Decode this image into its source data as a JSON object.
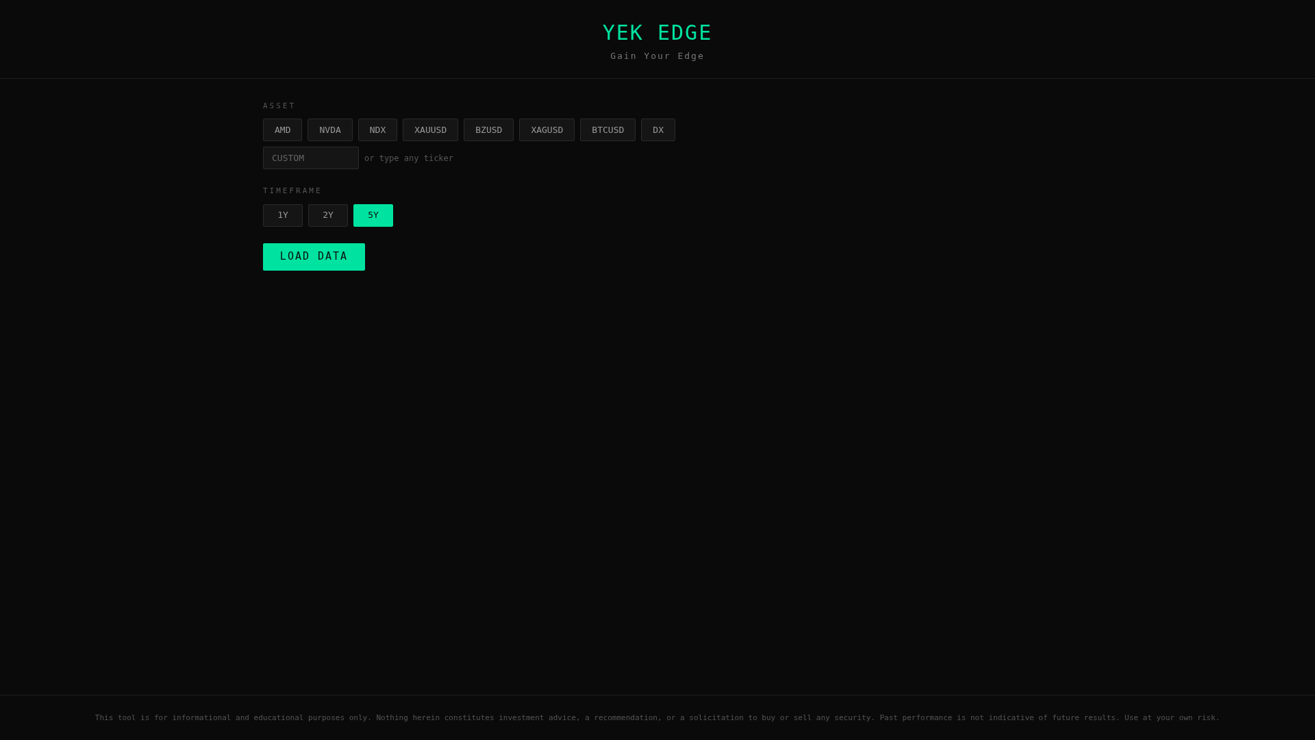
{
  "header": {
    "title": "YEK EDGE",
    "subtitle": "Gain Your Edge"
  },
  "asset": {
    "label": "ASSET",
    "options": [
      {
        "label": "AMD",
        "selected": false
      },
      {
        "label": "NVDA",
        "selected": false
      },
      {
        "label": "NDX",
        "selected": false
      },
      {
        "label": "XAUUSD",
        "selected": false
      },
      {
        "label": "BZUSD",
        "selected": false
      },
      {
        "label": "XAGUSD",
        "selected": false
      },
      {
        "label": "BTCUSD",
        "selected": false
      },
      {
        "label": "DX",
        "selected": false
      }
    ],
    "custom": {
      "placeholder": "CUSTOM",
      "hint": "or type any ticker"
    }
  },
  "timeframe": {
    "label": "TIMEFRAME",
    "options": [
      {
        "label": "1Y",
        "selected": false
      },
      {
        "label": "2Y",
        "selected": false
      },
      {
        "label": "5Y",
        "selected": true
      }
    ]
  },
  "load_button": "LOAD DATA",
  "footer": "This tool is for informational and educational purposes only. Nothing herein constitutes investment advice, a recommendation, or a solicitation to buy or sell any security. Past performance is not indicative of future results. Use at your own risk."
}
